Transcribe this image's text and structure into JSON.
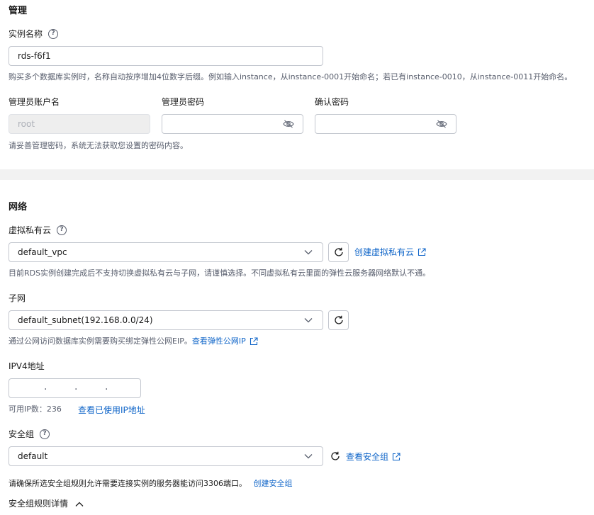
{
  "admin_section": {
    "title": "管理",
    "instance_name_label": "实例名称",
    "instance_name_value": "rds-f6f1",
    "instance_name_hint": "购买多个数据库实例时，名称自动按序增加4位数字后缀。例如输入instance，从instance-0001开始命名；若已有instance-0010，从instance-0011开始命名。",
    "admin_account_label": "管理员账户名",
    "admin_account_value": "root",
    "admin_password_label": "管理员密码",
    "confirm_password_label": "确认密码",
    "password_hint": "请妥善管理密码，系统无法获取您设置的密码内容。"
  },
  "network_section": {
    "title": "网络",
    "vpc_label": "虚拟私有云",
    "vpc_value": "default_vpc",
    "create_vpc_link": "创建虚拟私有云",
    "vpc_hint": "目前RDS实例创建完成后不支持切换虚拟私有云与子网，请谨慎选择。不同虚拟私有云里面的弹性云服务器网络默认不通。",
    "subnet_label": "子网",
    "subnet_value": "default_subnet(192.168.0.0/24)",
    "subnet_hint": "通过公网访问数据库实例需要购买绑定弹性公网EIP。",
    "view_eip_link": "查看弹性公网IP",
    "ipv4_label": "IPV4地址",
    "available_ip_label": "可用IP数：",
    "available_ip_count": "236",
    "view_used_ip_link": "查看已使用IP地址",
    "security_group_label": "安全组",
    "security_group_value": "default",
    "view_security_group_link": "查看安全组",
    "security_group_hint": "请确保所选安全组规则允许需要连接实例的服务器能访问3306端口。",
    "create_security_group_link": "创建安全组",
    "security_group_rules_label": "安全组规则详情"
  },
  "icons": {
    "help": "question-circle-icon",
    "eye": "eye-hidden-icon",
    "dropdown": "chevron-down-icon",
    "refresh": "refresh-icon",
    "external": "external-link-icon",
    "collapse": "chevron-up-icon"
  },
  "colors": {
    "link": "#0e64c8",
    "text": "#191919",
    "hint": "#575d6c",
    "border": "#c3c7cf",
    "divider": "#f2f2f2",
    "disabled_bg": "#eeeeee"
  }
}
